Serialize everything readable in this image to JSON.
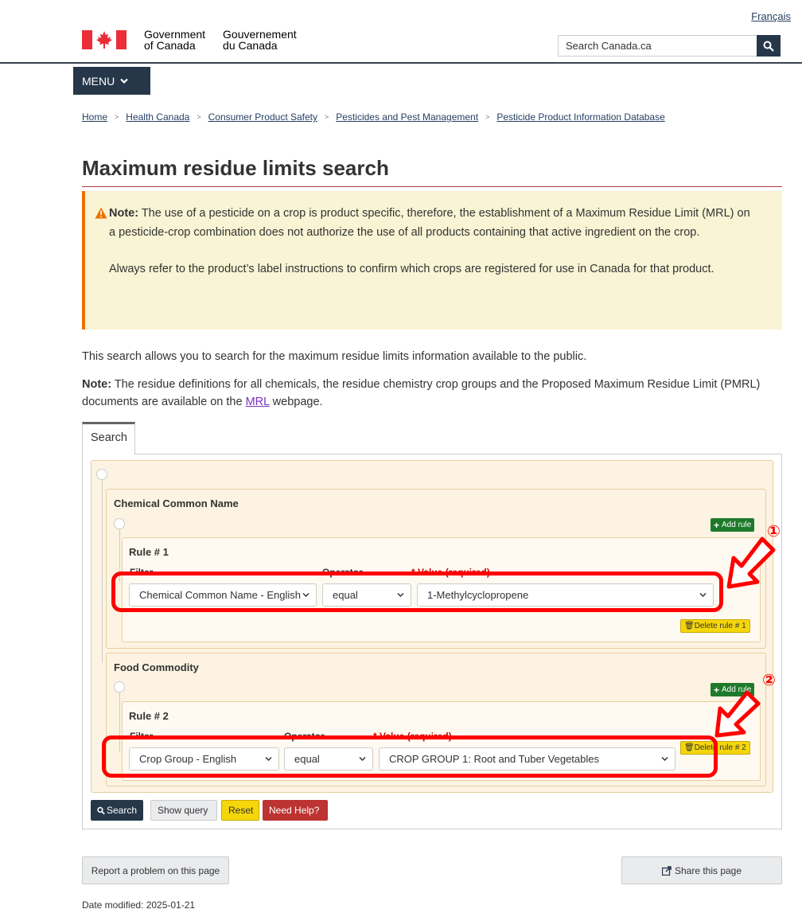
{
  "header": {
    "language_link": "Français",
    "gov_en_line1": "Government",
    "gov_en_line2": "of Canada",
    "gov_fr_line1": "Gouvernement",
    "gov_fr_line2": "du Canada",
    "search_placeholder": "Search Canada.ca",
    "menu_label": "MENU"
  },
  "breadcrumb": [
    "Home",
    "Health Canada",
    "Consumer Product Safety",
    "Pesticides and Pest Management",
    "Pesticide Product Information Database"
  ],
  "page_title": "Maximum residue limits search",
  "alert": {
    "label": "Note:",
    "text1": " The use of a pesticide on a crop is product specific, therefore, the establishment of a Maximum Residue Limit (MRL) on a pesticide-crop combination does not authorize the use of all products containing that active ingredient on the crop.",
    "text2": "Always refer to the product’s label instructions to confirm which crops are registered for use in Canada for that product."
  },
  "intro": "This search allows you to search for the maximum residue limits information available to the public.",
  "note": {
    "label": "Note:",
    "text_before": " The residue definitions for all chemicals, the residue chemistry crop groups and the Proposed Maximum Residue Limit (PMRL) documents are available on the ",
    "link": "MRL",
    "text_after": " webpage."
  },
  "tab_label": "Search",
  "groups": [
    {
      "title": "Chemical Common Name",
      "add_rule": "Add rule",
      "rule": {
        "title": "Rule # 1",
        "filter_label": "Filter",
        "operator_label": "Operator",
        "value_label": "* Value (required)",
        "filter": "Chemical Common Name - English",
        "operator": "equal",
        "value": "1-Methylcyclopropene",
        "delete": "Delete rule # 1"
      }
    },
    {
      "title": "Food Commodity",
      "add_rule": "Add rule",
      "rule": {
        "title": "Rule # 2",
        "filter_label": "Filter",
        "operator_label": "Operator",
        "value_label": "* Value (required)",
        "filter": "Crop Group - English",
        "operator": "equal",
        "value": "CROP GROUP 1: Root and Tuber Vegetables",
        "delete": "Delete rule # 2"
      }
    }
  ],
  "annotations": [
    "①",
    "②"
  ],
  "actions": {
    "search": "Search",
    "show_query": "Show query",
    "reset": "Reset",
    "help": "Need Help?"
  },
  "footer": {
    "report": "Report a problem on this page",
    "share": "Share this page",
    "date_modified": "Date modified: 2025-01-21"
  },
  "colors": {
    "annotation_red": "#ff0000",
    "add_green": "#1e7a2b",
    "delete_yellow": "#f5d60a",
    "search_blue": "#26374a",
    "help_red": "#bc3331"
  }
}
